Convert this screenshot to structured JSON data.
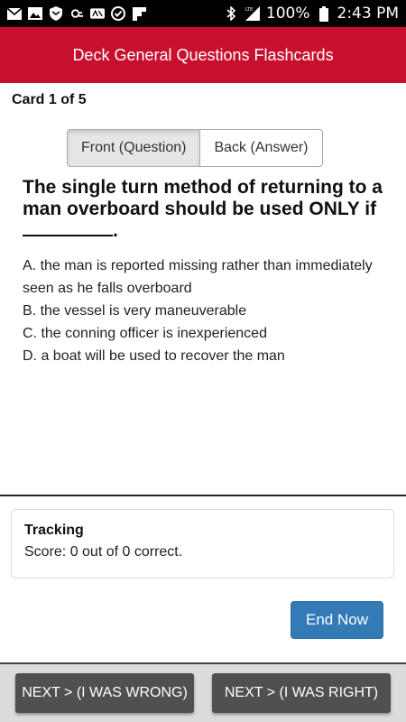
{
  "status_bar": {
    "battery_percent": "100%",
    "time": "2:43 PM",
    "icons_left": [
      "mail-icon",
      "image-icon",
      "shield-icon",
      "cloud-icon",
      "mlb-icon",
      "check-circle-icon",
      "flipboard-icon"
    ],
    "icons_right": [
      "bluetooth-icon",
      "lte-signal-icon",
      "battery-icon"
    ]
  },
  "header": {
    "title": "Deck General Questions Flashcards",
    "color": "#c8102e"
  },
  "card": {
    "counter": "Card 1 of 5",
    "tabs": {
      "front": "Front (Question)",
      "back": "Back (Answer)",
      "active": "front"
    },
    "question": "The single turn method of returning to a man overboard should be used ONLY if",
    "question_end": ".",
    "answers": [
      "A. the man is reported missing rather than immediately seen as he falls overboard",
      "B. the vessel is very maneuverable",
      "C. the conning officer is inexperienced",
      "D. a boat will be used to recover the man"
    ]
  },
  "tracking": {
    "title": "Tracking",
    "score": "Score: 0 out of 0 correct."
  },
  "actions": {
    "end_label": "End Now",
    "end_color": "#337ab7",
    "wrong_label": "NEXT > (I WAS WRONG)",
    "right_label": "NEXT > (I WAS RIGHT)"
  }
}
